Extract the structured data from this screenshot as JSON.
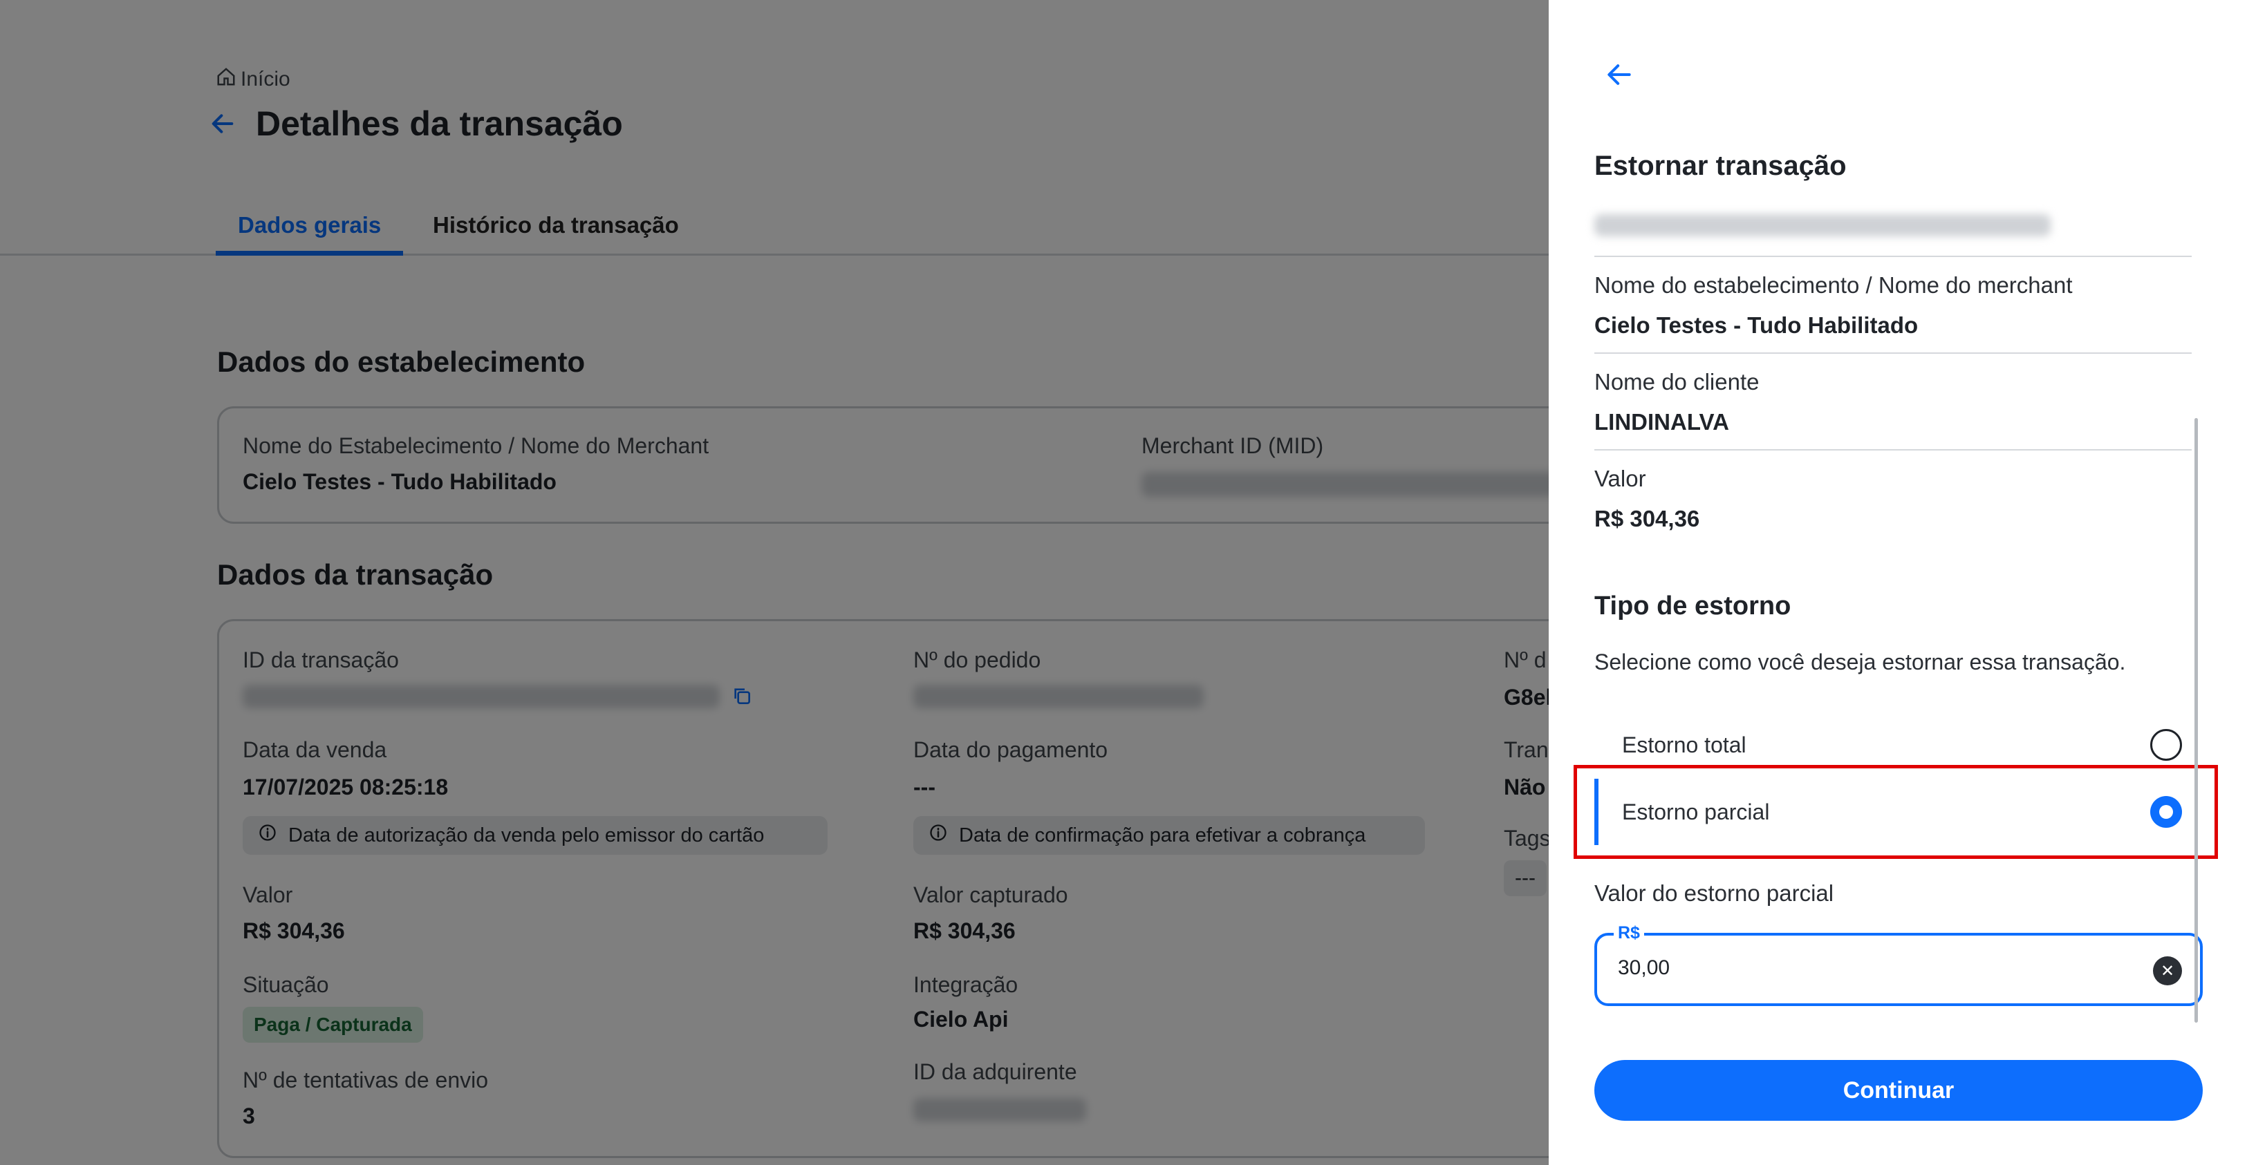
{
  "colors": {
    "accent": "#0d6efd",
    "highlight": "#e00000",
    "badge_bg": "#d9efe0",
    "badge_text": "#166534"
  },
  "breadcrumb": {
    "icon": "home-icon",
    "label": "Início"
  },
  "page": {
    "title": "Detalhes da transação"
  },
  "tabs": [
    {
      "label": "Dados gerais",
      "active": true
    },
    {
      "label": "Histórico da transação",
      "active": false
    }
  ],
  "establishment": {
    "section_title": "Dados do estabelecimento",
    "name_label": "Nome do Estabelecimento / Nome do Merchant",
    "name_value": "Cielo Testes - Tudo Habilitado",
    "mid_label": "Merchant ID (MID)"
  },
  "transaction": {
    "section_title": "Dados da transação",
    "col1": {
      "id_label": "ID da transação",
      "sale_date_label": "Data da venda",
      "sale_date_value": "17/07/2025 08:25:18",
      "sale_date_info": "Data de autorização da venda pelo emissor do cartão",
      "value_label": "Valor",
      "value_value": "R$ 304,36",
      "status_label": "Situação",
      "status_value": "Paga / Capturada",
      "attempts_label": "Nº de tentativas de envio",
      "attempts_value": "3"
    },
    "col2": {
      "order_label": "Nº do pedido",
      "payment_date_label": "Data do pagamento",
      "payment_date_value": "---",
      "payment_date_info": "Data de confirmação para efetivar a cobrança",
      "captured_label": "Valor capturado",
      "captured_value": "R$ 304,36",
      "integration_label": "Integração",
      "integration_value": "Cielo Api",
      "acquirer_label": "ID da adquirente"
    },
    "col3": {
      "label1": "Nº d",
      "value1": "G8el",
      "label2": "Tran",
      "value2": "Não",
      "label3": "Tags",
      "value3": "---"
    }
  },
  "panel": {
    "title": "Estornar transação",
    "merchant_label": "Nome do estabelecimento / Nome do merchant",
    "merchant_value": "Cielo Testes - Tudo Habilitado",
    "client_label": "Nome do cliente",
    "client_value": "LINDINALVA",
    "value_label": "Valor",
    "value_value": "R$ 304,36",
    "refund_type_title": "Tipo de estorno",
    "refund_type_subtitle": "Selecione como você deseja estornar essa transação.",
    "options": [
      {
        "label": "Estorno total",
        "selected": false
      },
      {
        "label": "Estorno parcial",
        "selected": true
      }
    ],
    "partial_label": "Valor do estorno parcial",
    "field_legend": "R$",
    "field_value": "30,00",
    "continue_label": "Continuar"
  }
}
